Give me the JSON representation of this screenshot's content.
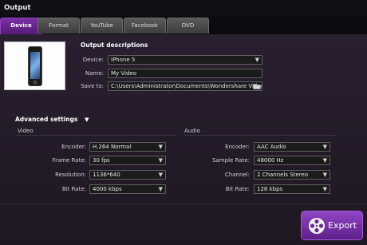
{
  "window": {
    "title": "Output"
  },
  "tabs": [
    {
      "label": "Device",
      "active": true
    },
    {
      "label": "Format",
      "active": false
    },
    {
      "label": "YouTube",
      "active": false
    },
    {
      "label": "Facebook",
      "active": false
    },
    {
      "label": "DVD",
      "active": false
    }
  ],
  "output": {
    "heading": "Output descriptions",
    "device_label": "Device:",
    "device_value": "iPhone 5",
    "name_label": "Name:",
    "name_value": "My Video",
    "save_label": "Save to:",
    "save_value": "C:\\Users\\Administrator\\Documents\\Wondershare Video Editor"
  },
  "advanced": {
    "heading": "Advanced settings",
    "video": {
      "title": "Video",
      "encoder_label": "Encoder:",
      "encoder_value": "H.264 Normal",
      "framerate_label": "Frame Rate:",
      "framerate_value": "30 fps",
      "resolution_label": "Resolution:",
      "resolution_value": "1136*640",
      "bitrate_label": "Bit Rate:",
      "bitrate_value": "4000 kbps"
    },
    "audio": {
      "title": "Audio",
      "encoder_label": "Encoder:",
      "encoder_value": "AAC Audio",
      "samplerate_label": "Sample Rate:",
      "samplerate_value": "48000 Hz",
      "channel_label": "Channel:",
      "channel_value": "2 Channels Stereo",
      "bitrate_label": "Bit Rate:",
      "bitrate_value": "128 kbps"
    }
  },
  "export_button": {
    "label": "Export"
  },
  "icons": {
    "dropdown": "chevron-down-icon",
    "folder": "folder-icon",
    "export": "film-reel-icon",
    "advanced_toggle": "triangle-down-icon"
  },
  "colors": {
    "accent": "#7a2fa5",
    "export_button": "#8f45c4",
    "background": "#221a27"
  }
}
